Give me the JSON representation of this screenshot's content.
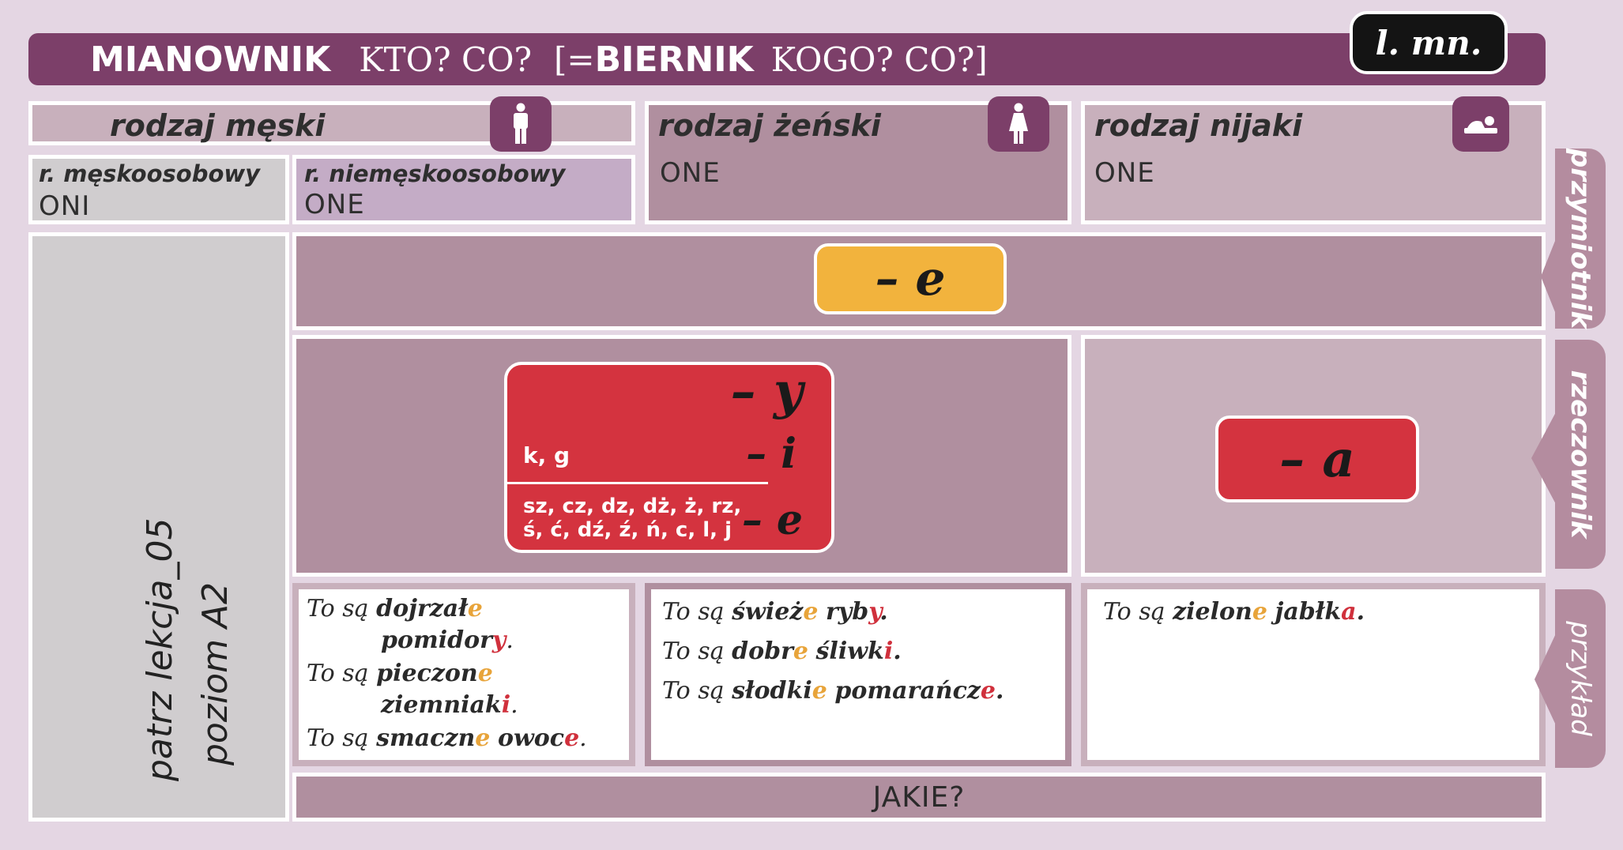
{
  "header": {
    "case1": "MIANOWNIK",
    "q1": "KTO? CO?",
    "bracket_open": "[=",
    "case2": "BIERNIK",
    "q2": "KOGO? CO?]",
    "number_badge": "l. mn."
  },
  "genders": {
    "masculine": {
      "title": "rodzaj męski",
      "icon": "man-icon",
      "personal": {
        "title": "r. męskoosobowy",
        "pronoun": "ONI"
      },
      "nonpersonal": {
        "title": "r. niemęskoosobowy",
        "pronoun": "ONE"
      }
    },
    "feminine": {
      "title": "rodzaj żeński",
      "icon": "woman-icon",
      "pronoun": "ONE"
    },
    "neuter": {
      "title": "rodzaj nijaki",
      "icon": "baby-icon",
      "pronoun": "ONE"
    }
  },
  "side_labels": {
    "adjective": "przymiotnik",
    "noun": "rzeczownik",
    "example": "przykład"
  },
  "adjective_ending": "– e",
  "noun_endings": {
    "main": "– y",
    "kg_label": "k, g",
    "kg_ending": "– i",
    "soft_label_line1": "sz, cz, dz, dż, ż, rz,",
    "soft_label_line2": "ś, ć, dź, ź, ń, c, l, j",
    "soft_ending": "– e",
    "neuter_ending": "– a"
  },
  "reference": {
    "line1": "patrz lekcja_05",
    "line2": "poziom A2"
  },
  "examples": {
    "col1": [
      {
        "pre": "To są ",
        "adj": "dojrzał",
        "adj_end": "e",
        "noun": "pomidor",
        "noun_end": "y",
        "dot": "."
      },
      {
        "pre": "To są ",
        "adj": "pieczon",
        "adj_end": "e",
        "noun": "ziemniak",
        "noun_end": "i",
        "dot": "."
      },
      {
        "pre": "To są ",
        "adj": "smaczn",
        "adj_end": "e",
        "noun": "owoc",
        "noun_end": "e",
        "dot": "."
      }
    ],
    "col2": [
      {
        "pre": "To są ",
        "adj": "śwież",
        "adj_end": "e",
        "noun": "ryb",
        "noun_end": "y",
        "dot": "."
      },
      {
        "pre": "To są ",
        "adj": "dobr",
        "adj_end": "e",
        "noun": "śliwk",
        "noun_end": "i",
        "dot": "."
      },
      {
        "pre": "To są ",
        "adj": "słodki",
        "adj_end": "e",
        "noun": "pomarańcz",
        "noun_end": "e",
        "dot": "."
      }
    ],
    "col3": [
      {
        "pre": "To są ",
        "adj": "zielon",
        "adj_end": "e",
        "noun": "jabłk",
        "noun_end": "a",
        "dot": "."
      }
    ]
  },
  "question": "JAKIE?",
  "colors": {
    "plum": "#7c3f69",
    "mauve": "#b08f9f",
    "yellow": "#f2b33d",
    "red": "#d4333f"
  }
}
